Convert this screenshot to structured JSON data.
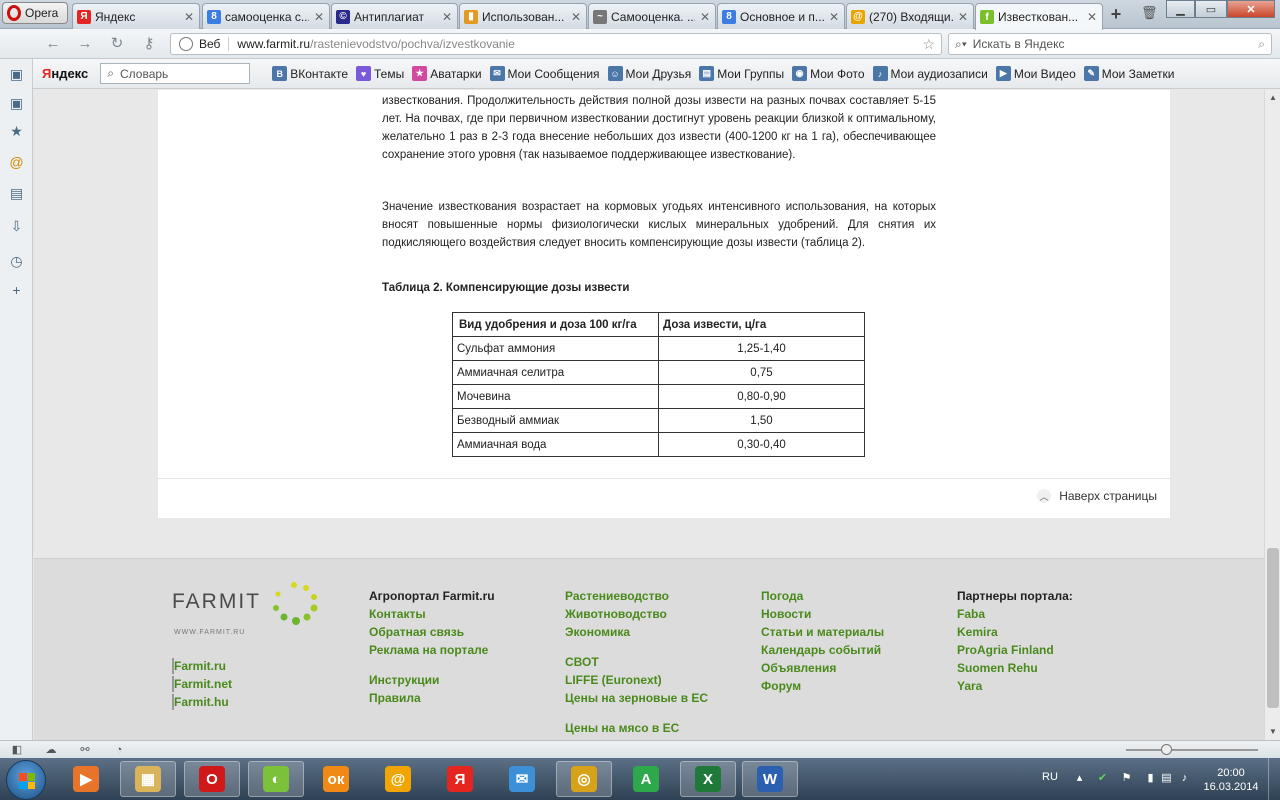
{
  "browser": {
    "menu_label": "Opera",
    "tabs": [
      {
        "label": "Яндекс",
        "icon": "yandex-icon",
        "color": "#e52620",
        "glyph": "Я"
      },
      {
        "label": "самооценка с...",
        "icon": "google-icon",
        "color": "#3b7de0",
        "glyph": "8"
      },
      {
        "label": "Антиплагиат",
        "icon": "antiplagiat-icon",
        "color": "#2a2a8c",
        "glyph": "©"
      },
      {
        "label": "Использован...",
        "icon": "chart-icon",
        "color": "#e39a20",
        "glyph": "▮"
      },
      {
        "label": "Самооценка. ...",
        "icon": "wave-icon",
        "color": "#777777",
        "glyph": "~"
      },
      {
        "label": "Основное и п...",
        "icon": "google-icon",
        "color": "#3b7de0",
        "glyph": "8"
      },
      {
        "label": "(270) Входящи...",
        "icon": "mail-icon",
        "color": "#e8a400",
        "glyph": "@"
      },
      {
        "label": "Известкован...",
        "icon": "farmit-icon",
        "color": "#7bbf2a",
        "glyph": "f"
      }
    ],
    "address": {
      "scheme": "Веб",
      "host": "www.farmit.ru",
      "path": "/rastenievodstvo/pochva/izvestkovanie"
    },
    "search_placeholder": "Искать в Яндекс"
  },
  "yandex_bar": {
    "logo_prefix": "Я",
    "logo_rest": "ндекс",
    "dictionary": "Словарь",
    "links": [
      {
        "label": "ВКонтакте",
        "icon": "vk-icon",
        "color": "#4a76a8",
        "glyph": "B"
      },
      {
        "label": "Темы",
        "icon": "heart-icon",
        "color": "#7a5ad8",
        "glyph": "♥"
      },
      {
        "label": "Аватарки",
        "icon": "star-icon",
        "color": "#d04aa0",
        "glyph": "★"
      },
      {
        "label": "Мои Сообщения",
        "icon": "messages-icon",
        "color": "#4a76a8",
        "glyph": "✉"
      },
      {
        "label": "Мои Друзья",
        "icon": "friends-icon",
        "color": "#4a76a8",
        "glyph": "☺"
      },
      {
        "label": "Мои Группы",
        "icon": "groups-icon",
        "color": "#4a76a8",
        "glyph": "▤"
      },
      {
        "label": "Мои Фото",
        "icon": "camera-icon",
        "color": "#4a76a8",
        "glyph": "◉"
      },
      {
        "label": "Мои аудиозаписи",
        "icon": "audio-icon",
        "color": "#4a76a8",
        "glyph": "♪"
      },
      {
        "label": "Мои Видео",
        "icon": "video-icon",
        "color": "#4a76a8",
        "glyph": "▶"
      },
      {
        "label": "Мои Заметки",
        "icon": "notes-icon",
        "color": "#4a76a8",
        "glyph": "✎"
      }
    ]
  },
  "article": {
    "para1": "растениями, известкованные почвы постепенно подкисляются и возникает необходимость повторного известкования. Продолжительность действия полной дозы извести на разных почвах составляет 5-15 лет. На почвах, где при первичном известковании достигнут уровень реакции близкой к оптимальному, желательно 1 раз в 2-3 года внесение небольших доз извести (400-1200 кг на 1 га), обеспечивающее сохранение этого уровня (так называемое поддерживающее известкование).",
    "para2": "Значение известкования возрастает на кормовых угодьях интенсивного использования, на которых вносят повышенные нормы физиологически кислых минеральных удобрений. Для снятия их подкисляющего воздействия следует вносить компенсирующие дозы извести (таблица 2).",
    "table_title": "Таблица 2. Компенсирующие дозы извести",
    "table": {
      "headers": [
        "Вид удобрения и доза 100 кг/га",
        "Доза извести, ц/га"
      ],
      "rows": [
        [
          "Сульфат аммония",
          "1,25-1,40"
        ],
        [
          "Аммиачная селитра",
          "0,75"
        ],
        [
          "Мочевина",
          "0,80-0,90"
        ],
        [
          "Безводный аммиак",
          "1,50"
        ],
        [
          "Аммиачная вода",
          "0,30-0,40"
        ]
      ]
    },
    "back_to_top": "Наверх страницы"
  },
  "footer": {
    "logo_word": "FARMIT",
    "logo_sub": "WWW.FARMIT.RU",
    "sites": [
      "Farmit.ru",
      "Farmit.net",
      "Farmit.hu"
    ],
    "col1": {
      "head": "Агропортал Farmit.ru",
      "links": [
        "Контакты",
        "Обратная связь",
        "Реклама на портале"
      ],
      "links2": [
        "Инструкции",
        "Правила"
      ]
    },
    "col2": {
      "links": [
        "Растениеводство",
        "Животноводство",
        "Экономика"
      ],
      "links2": [
        "СВОТ",
        "LIFFE (Euronext)",
        "Цены на зерновые в ЕС"
      ],
      "links3": [
        "Цены на мясо в ЕС"
      ]
    },
    "col3": {
      "links": [
        "Погода",
        "Новости",
        "Статьи и материалы",
        "Календарь событий",
        "Объявления",
        "Форум"
      ]
    },
    "col4": {
      "head": "Партнеры портала:",
      "links": [
        "Faba",
        "Kemira",
        "ProAgria Finland",
        "Suomen Rehu",
        "Yara"
      ]
    }
  },
  "taskbar": {
    "lang": "RU",
    "time": "20:00",
    "date": "16.03.2014",
    "apps": [
      {
        "name": "media-player-icon",
        "color": "#e8742a",
        "glyph": "▶"
      },
      {
        "name": "file-explorer-icon",
        "color": "#d9b45a",
        "glyph": "▦"
      },
      {
        "name": "opera-icon",
        "color": "#d01818",
        "glyph": "O"
      },
      {
        "name": "green-ball-icon",
        "color": "#7cc13a",
        "glyph": "◐"
      },
      {
        "name": "odnoklassniki-icon",
        "color": "#f18a15",
        "glyph": "ок"
      },
      {
        "name": "mail-agent-icon",
        "color": "#f0a500",
        "glyph": "@"
      },
      {
        "name": "yandex-browser-icon",
        "color": "#e52620",
        "glyph": "Я"
      },
      {
        "name": "email-icon",
        "color": "#3d8fd8",
        "glyph": "✉"
      },
      {
        "name": "chrome-icon",
        "color": "#d6a21a",
        "glyph": "◎"
      },
      {
        "name": "a-game-icon",
        "color": "#2da84a",
        "glyph": "A"
      },
      {
        "name": "excel-icon",
        "color": "#1f7a3a",
        "glyph": "X"
      },
      {
        "name": "word-icon",
        "color": "#2b5fb0",
        "glyph": "W"
      }
    ]
  }
}
